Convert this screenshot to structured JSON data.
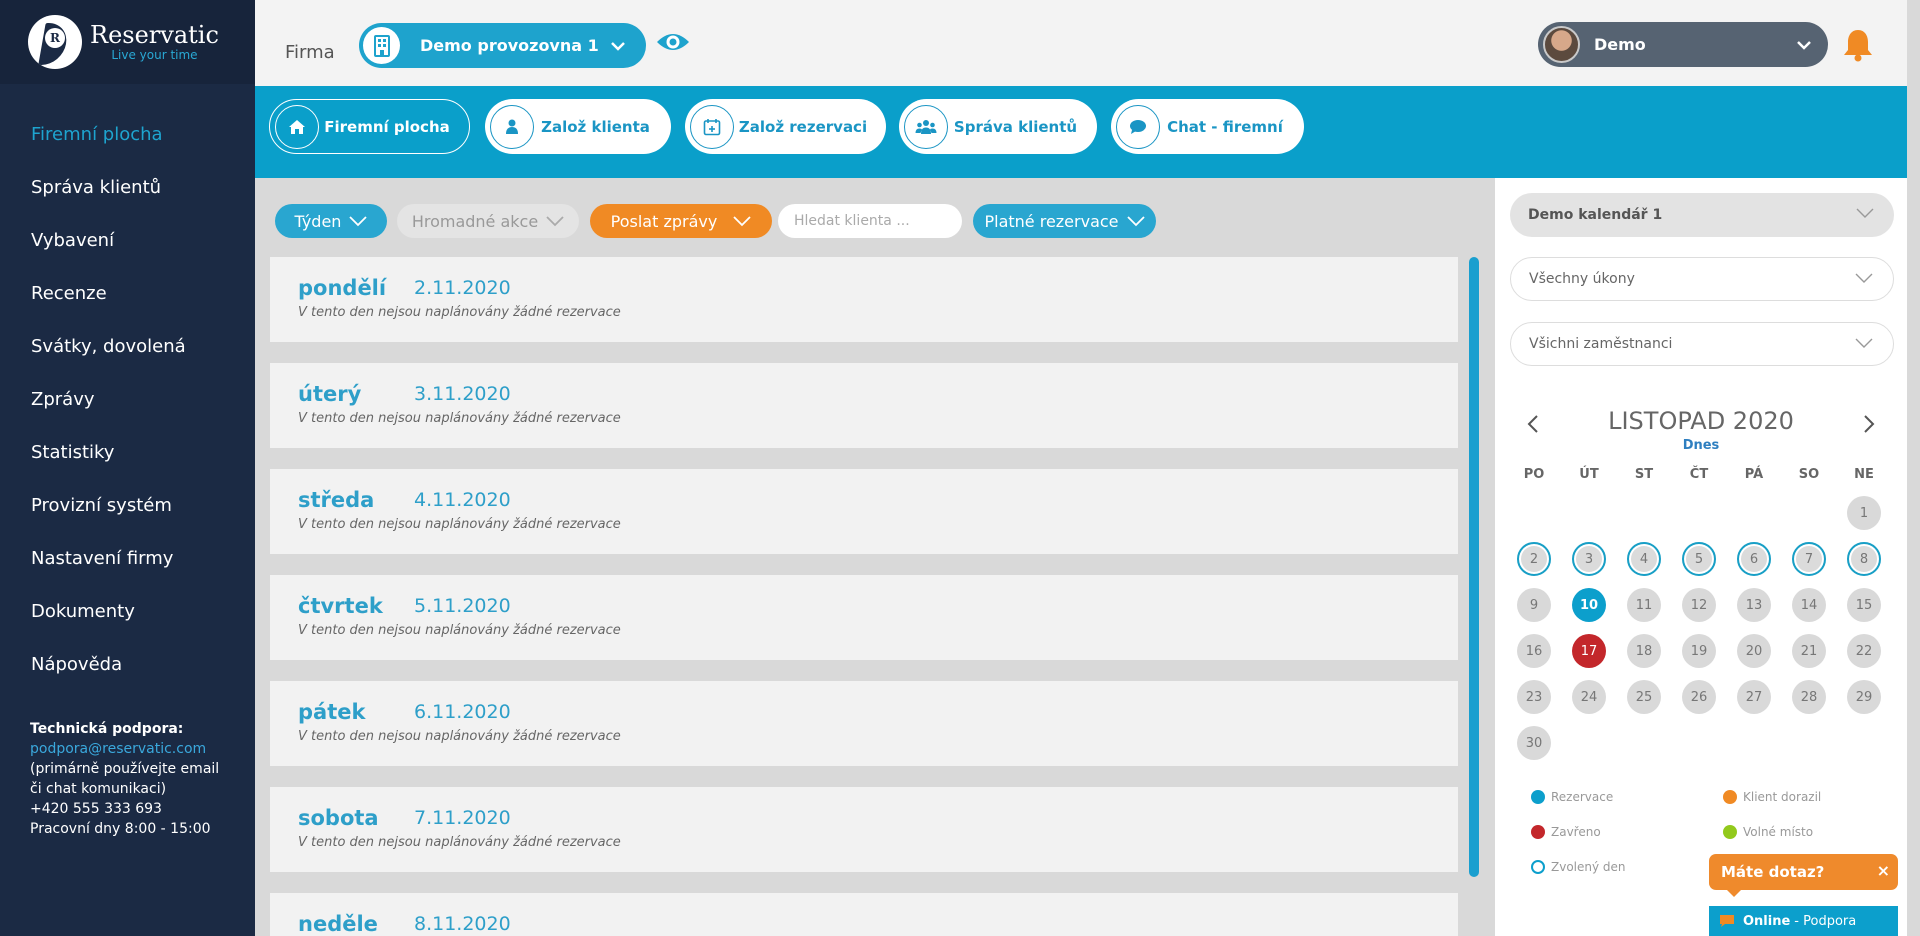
{
  "brand": {
    "title": "Reservatic",
    "slogan": "Live your time",
    "logo_letter": "R"
  },
  "sidebar": {
    "items": [
      {
        "label": "Firemní plocha",
        "active": true
      },
      {
        "label": "Správa klientů"
      },
      {
        "label": "Vybavení"
      },
      {
        "label": "Recenze"
      },
      {
        "label": "Svátky, dovolená"
      },
      {
        "label": "Zprávy"
      },
      {
        "label": "Statistiky"
      },
      {
        "label": "Provizní systém"
      },
      {
        "label": "Nastavení firmy"
      },
      {
        "label": "Dokumenty"
      },
      {
        "label": "Nápověda"
      }
    ],
    "support": {
      "title": "Technická podpora:",
      "email": "podpora@reservatic.com",
      "note": "(primárně používejte email či chat komunikaci)",
      "phone": "+420 555 333 693",
      "hours": "Pracovní dny 8:00 - 15:00"
    }
  },
  "topbar": {
    "firma_label": "Firma",
    "provozovna": "Demo provozovna 1",
    "user_name": "Demo"
  },
  "actions": [
    {
      "label": "Firemní plocha",
      "icon": "home-icon"
    },
    {
      "label": "Založ klienta",
      "icon": "user-icon"
    },
    {
      "label": "Založ rezervaci",
      "icon": "calendar-plus-icon"
    },
    {
      "label": "Správa klientů",
      "icon": "users-icon"
    },
    {
      "label": "Chat - firemní",
      "icon": "chat-bubble-icon"
    }
  ],
  "filters": {
    "period": "Týden",
    "bulk": "Hromadné akce",
    "send": "Poslat zprávy",
    "search_placeholder": "Hledat klienta ...",
    "valid": "Platné rezervace"
  },
  "days": [
    {
      "name": "pondělí",
      "date": "2.11.2020",
      "note": "V tento den nejsou naplánovány žádné rezervace"
    },
    {
      "name": "úterý",
      "date": "3.11.2020",
      "note": "V tento den nejsou naplánovány žádné rezervace"
    },
    {
      "name": "středa",
      "date": "4.11.2020",
      "note": "V tento den nejsou naplánovány žádné rezervace"
    },
    {
      "name": "čtvrtek",
      "date": "5.11.2020",
      "note": "V tento den nejsou naplánovány žádné rezervace"
    },
    {
      "name": "pátek",
      "date": "6.11.2020",
      "note": "V tento den nejsou naplánovány žádné rezervace"
    },
    {
      "name": "sobota",
      "date": "7.11.2020",
      "note": "V tento den nejsou naplánovány žádné rezervace"
    },
    {
      "name": "neděle",
      "date": "8.11.2020",
      "note": ""
    }
  ],
  "right_panel": {
    "calendar_select": "Demo kalendář 1",
    "services_select": "Všechny úkony",
    "employees_select": "Všichni zaměstnanci",
    "month": "LISTOPAD 2020",
    "today_link": "Dnes",
    "weekdays": [
      "PO",
      "ÚT",
      "ST",
      "ČT",
      "PÁ",
      "SO",
      "NE"
    ],
    "days": [
      {
        "d": "1",
        "col": 6,
        "row": 0,
        "state": "normal"
      },
      {
        "d": "2",
        "col": 0,
        "row": 1,
        "state": "selected"
      },
      {
        "d": "3",
        "col": 1,
        "row": 1,
        "state": "selected"
      },
      {
        "d": "4",
        "col": 2,
        "row": 1,
        "state": "selected"
      },
      {
        "d": "5",
        "col": 3,
        "row": 1,
        "state": "selected"
      },
      {
        "d": "6",
        "col": 4,
        "row": 1,
        "state": "selected"
      },
      {
        "d": "7",
        "col": 5,
        "row": 1,
        "state": "selected"
      },
      {
        "d": "8",
        "col": 6,
        "row": 1,
        "state": "selected"
      },
      {
        "d": "9",
        "col": 0,
        "row": 2,
        "state": "normal"
      },
      {
        "d": "10",
        "col": 1,
        "row": 2,
        "state": "today"
      },
      {
        "d": "11",
        "col": 2,
        "row": 2,
        "state": "normal"
      },
      {
        "d": "12",
        "col": 3,
        "row": 2,
        "state": "normal"
      },
      {
        "d": "13",
        "col": 4,
        "row": 2,
        "state": "normal"
      },
      {
        "d": "14",
        "col": 5,
        "row": 2,
        "state": "normal"
      },
      {
        "d": "15",
        "col": 6,
        "row": 2,
        "state": "normal"
      },
      {
        "d": "16",
        "col": 0,
        "row": 3,
        "state": "normal"
      },
      {
        "d": "17",
        "col": 1,
        "row": 3,
        "state": "closed"
      },
      {
        "d": "18",
        "col": 2,
        "row": 3,
        "state": "normal"
      },
      {
        "d": "19",
        "col": 3,
        "row": 3,
        "state": "normal"
      },
      {
        "d": "20",
        "col": 4,
        "row": 3,
        "state": "normal"
      },
      {
        "d": "21",
        "col": 5,
        "row": 3,
        "state": "normal"
      },
      {
        "d": "22",
        "col": 6,
        "row": 3,
        "state": "normal"
      },
      {
        "d": "23",
        "col": 0,
        "row": 4,
        "state": "normal"
      },
      {
        "d": "24",
        "col": 1,
        "row": 4,
        "state": "normal"
      },
      {
        "d": "25",
        "col": 2,
        "row": 4,
        "state": "normal"
      },
      {
        "d": "26",
        "col": 3,
        "row": 4,
        "state": "normal"
      },
      {
        "d": "27",
        "col": 4,
        "row": 4,
        "state": "normal"
      },
      {
        "d": "28",
        "col": 5,
        "row": 4,
        "state": "normal"
      },
      {
        "d": "29",
        "col": 6,
        "row": 4,
        "state": "normal"
      },
      {
        "d": "30",
        "col": 0,
        "row": 5,
        "state": "normal"
      }
    ],
    "legend": [
      {
        "label": "Rezervace",
        "color": "#0c9fcc",
        "type": "fill"
      },
      {
        "label": "Klient dorazil",
        "color": "#f08a24",
        "type": "fill"
      },
      {
        "label": "Zavřeno",
        "color": "#c3272b",
        "type": "fill"
      },
      {
        "label": "Volné místo",
        "color": "#92c91c",
        "type": "fill"
      },
      {
        "label": "Zvolený den",
        "color": "#0c9fcc",
        "type": "ring"
      }
    ]
  },
  "chat": {
    "question": "Máte dotaz?",
    "close_symbol": "×",
    "online_status": "Online",
    "online_label": "- Podpora"
  },
  "colors": {
    "sidebar_bg": "#1b2a44",
    "accent": "#0a9fca",
    "orange": "#f08a24",
    "closed_red": "#c3272b"
  }
}
